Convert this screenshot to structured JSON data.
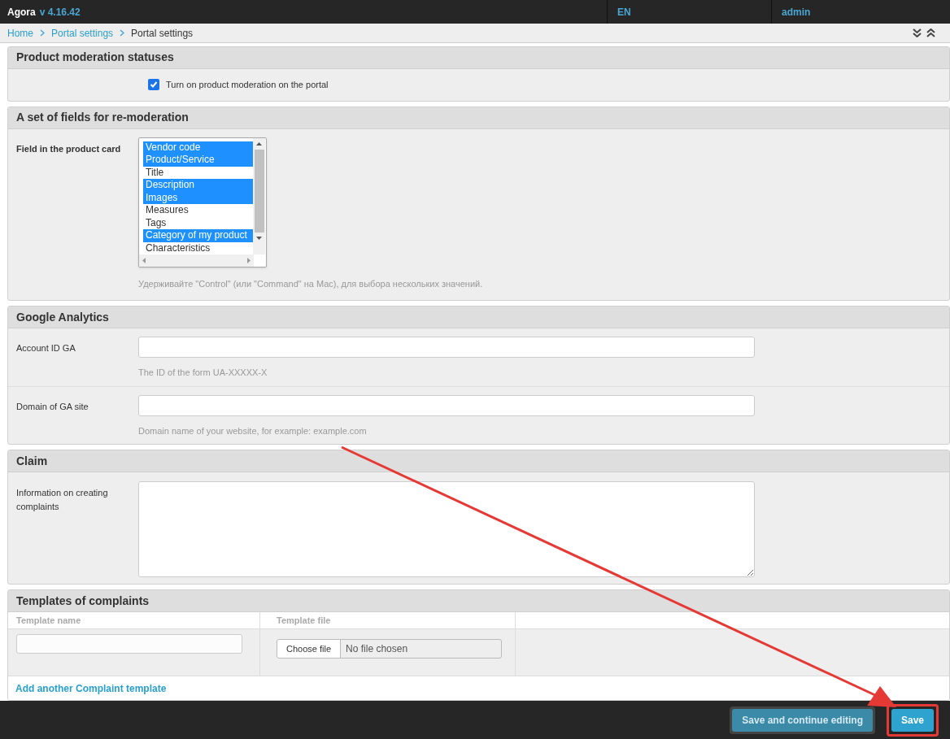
{
  "header": {
    "brand": "Agora",
    "version": "v 4.16.42",
    "language": "EN",
    "user": "admin"
  },
  "breadcrumbs": [
    {
      "label": "Home",
      "link": true
    },
    {
      "label": "Portal settings",
      "link": true
    },
    {
      "label": "Portal settings",
      "link": false
    }
  ],
  "sections": [
    {
      "kind": "checkbox",
      "title": "Product moderation statuses",
      "checkbox": {
        "label": "Turn on product moderation on the portal",
        "checked": true
      }
    },
    {
      "kind": "multiselect",
      "title": "A set of fields for re-moderation",
      "label": "Field in the product card",
      "options": [
        {
          "label": "Vendor code",
          "selected": true
        },
        {
          "label": "Product/Service",
          "selected": true
        },
        {
          "label": "Title",
          "selected": false
        },
        {
          "label": "Description",
          "selected": true
        },
        {
          "label": "Images",
          "selected": true
        },
        {
          "label": "Measures",
          "selected": false
        },
        {
          "label": "Tags",
          "selected": false
        },
        {
          "label": "Category of my product",
          "selected": true
        },
        {
          "label": "Characteristics",
          "selected": false
        }
      ],
      "help": "Удерживайте \"Control\" (или \"Command\" на Mac), для выбора нескольких значений."
    },
    {
      "kind": "fields",
      "title": "Google Analytics",
      "fields": [
        {
          "label": "Account ID GA",
          "help": "The ID of the form UA-XXXXX-X"
        },
        {
          "label": "Domain of GA site",
          "help": "Domain name of your website, for example: example.com"
        }
      ]
    },
    {
      "kind": "textarea",
      "title": "Claim",
      "label": "Information on creating complaints"
    },
    {
      "kind": "table",
      "title": "Templates of complaints",
      "columns": [
        "Template name",
        "Template file"
      ],
      "file_button": "Choose file",
      "file_status": "No file chosen",
      "add_link": "Add another Complaint template"
    }
  ],
  "footer": {
    "buttons": [
      {
        "label": "Save and continue editing",
        "highlighted": false
      },
      {
        "label": "Save",
        "highlighted": true
      }
    ]
  }
}
